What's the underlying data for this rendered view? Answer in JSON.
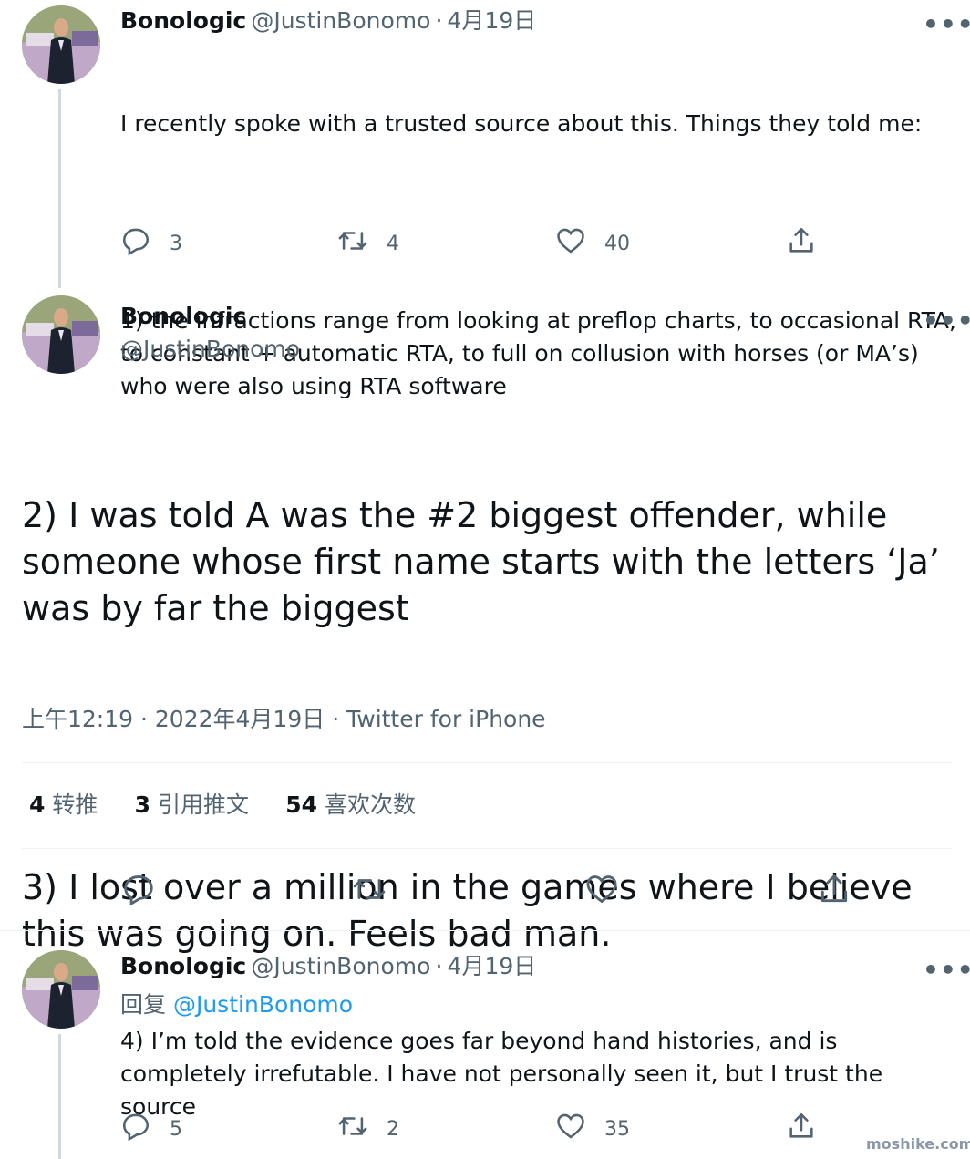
{
  "tweet1": {
    "name": "Bonologic",
    "handle": "@JustinBonomo",
    "date": "4月19日",
    "text_line1": "I recently spoke with a trusted source about this. Things they told me:",
    "text_rest": "1) the infractions range from looking at preflop charts, to occasional RTA, to constant + automatic RTA, to full on collusion with horses (or MA’s) who were also using RTA software",
    "replies": "3",
    "retweets": "4",
    "likes": "40"
  },
  "main_tweet": {
    "name": "Bonologic",
    "handle": "@JustinBonomo",
    "text_para1": "2) I was told A was the #2 biggest offender, while someone whose first name starts with the letters ‘Ja’ was by far the biggest",
    "text_para2": "3) I lost over a million in the games where I believe this was going on. Feels bad man.",
    "time": "上午12:19",
    "date": "2022年4月19日",
    "source": "Twitter for iPhone",
    "stats": {
      "retweets_num": "4",
      "retweets_label": "转推",
      "quotes_num": "3",
      "quotes_label": "引用推文",
      "likes_num": "54",
      "likes_label": "喜欢次数"
    }
  },
  "tweet3": {
    "name": "Bonologic",
    "handle": "@JustinBonomo",
    "date": "4月19日",
    "reply_prefix": "回复",
    "reply_to": "@JustinBonomo",
    "text": "4) I’m told the evidence goes far beyond hand histories, and is completely irrefutable. I have not personally seen it, but I trust the source",
    "replies": "5",
    "retweets": "2",
    "likes": "35"
  },
  "separator": "·",
  "more_glyph": "•••",
  "watermark": "moshike.com",
  "icons": [
    "reply-icon",
    "retweet-icon",
    "like-icon",
    "share-icon",
    "more-icon"
  ]
}
